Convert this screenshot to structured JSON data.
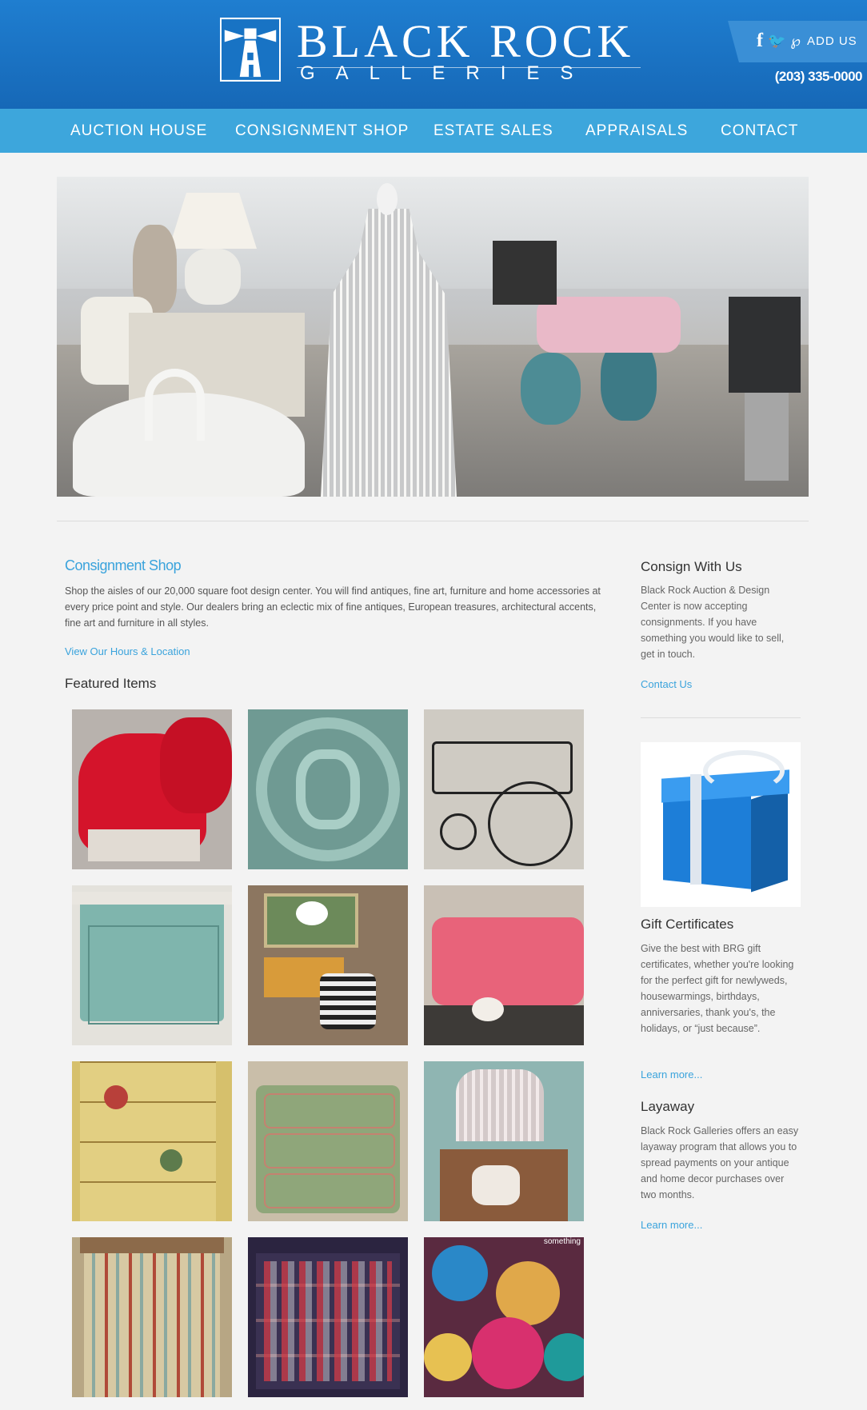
{
  "brand": {
    "title": "BLACK ROCK",
    "subtitle": "GALLERIES"
  },
  "header": {
    "social_add": "ADD US",
    "phone": "(203) 335-0000",
    "icons": [
      "facebook-icon",
      "twitter-icon",
      "pinterest-icon"
    ]
  },
  "nav": {
    "items": [
      {
        "label": "AUCTION HOUSE"
      },
      {
        "label": "CONSIGNMENT SHOP"
      },
      {
        "label": "ESTATE SALES"
      },
      {
        "label": "APPRAISALS"
      },
      {
        "label": "CONTACT"
      }
    ]
  },
  "main": {
    "section_title": "Consignment Shop",
    "section_body": "Shop the aisles of our 20,000 square foot design center.  You will find antiques, fine art, furniture and home accessories at every price point and style. Our dealers bring an eclectic mix of fine antiques, European treasures, architectural accents, fine art and furniture in all styles.",
    "hours_link": "View Our Hours & Location",
    "featured_title": "Featured Items",
    "featured_items": [
      {
        "name": "red-velvet-chairs"
      },
      {
        "name": "teal-iron-scrollwork"
      },
      {
        "name": "glass-tea-cart"
      },
      {
        "name": "blue-painted-cabinet"
      },
      {
        "name": "mid-century-room"
      },
      {
        "name": "pink-sofa"
      },
      {
        "name": "chinoiserie-secretary"
      },
      {
        "name": "painted-green-chest"
      },
      {
        "name": "coral-and-birdcage"
      },
      {
        "name": "croquet-mallets"
      },
      {
        "name": "ornament-shelves"
      },
      {
        "name": "christmas-ornaments"
      }
    ],
    "ornament_caption": "something"
  },
  "sidebar": {
    "consign_title": "Consign With Us",
    "consign_body": "Black Rock Auction & Design Center is now accepting consignments. If you have something you would like to sell, get in touch.",
    "consign_link": "Contact Us",
    "gift_title": "Gift Certificates",
    "gift_body": "Give the best with BRG gift certificates, whether you're looking for the perfect gift for newlyweds, housewarmings, birthdays, anniversaries, thank you's, the holidays, or “just because”.",
    "gift_link": "Learn more...",
    "layaway_title": "Layaway",
    "layaway_body": "Black Rock Galleries offers an easy layaway program that allows you to spread payments on your antique and home decor purchases over two months.",
    "layaway_link": "Learn more..."
  },
  "colors": {
    "header_blue": "#1f7ed0",
    "nav_blue": "#3da6dc",
    "link_blue": "#3aa3dc"
  }
}
